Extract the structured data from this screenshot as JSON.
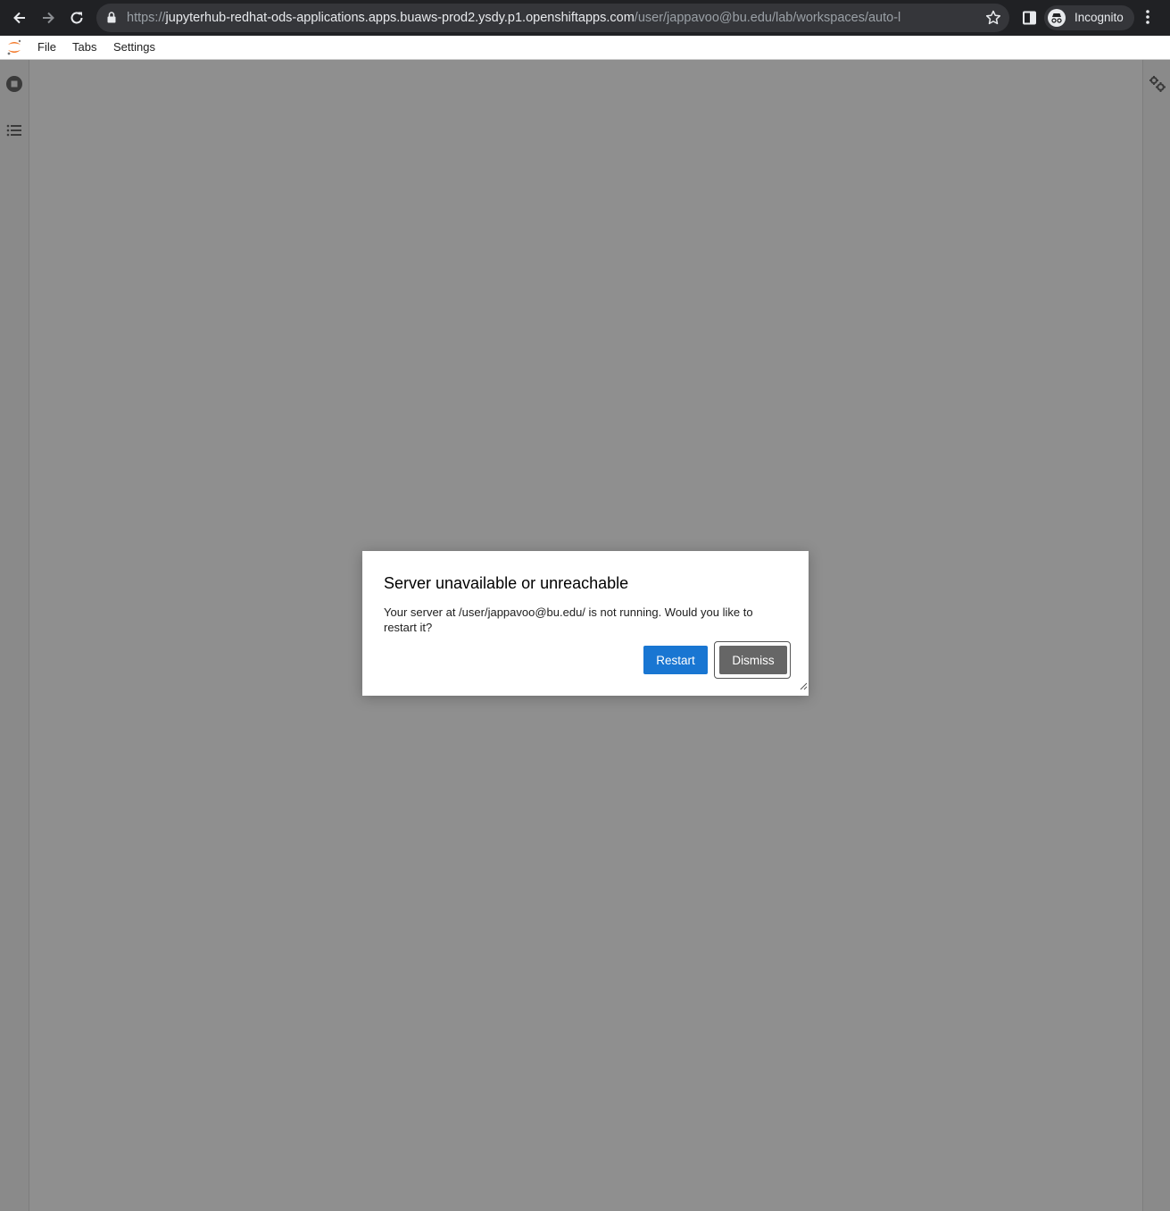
{
  "browser": {
    "url_scheme": "https://",
    "url_host": "jupyterhub-redhat-ods-applications.apps.buaws-prod2.ysdy.p1.openshiftapps.com",
    "url_path": "/user/jappavoo@bu.edu/lab/workspaces/auto-l",
    "profile_label": "Incognito"
  },
  "menubar": {
    "items": [
      {
        "label": "File"
      },
      {
        "label": "Tabs"
      },
      {
        "label": "Settings"
      }
    ]
  },
  "left_sidebar": {
    "icons": [
      "running-sessions-icon",
      "table-of-contents-icon"
    ]
  },
  "right_sidebar": {
    "icons": [
      "property-inspector-icon"
    ]
  },
  "dialog": {
    "title": "Server unavailable or unreachable",
    "body": "Your server at /user/jappavoo@bu.edu/ is not running. Would you like to restart it?",
    "restart_label": "Restart",
    "dismiss_label": "Dismiss"
  },
  "colors": {
    "accent": "#1976d2",
    "overlay": "#8f8f8f",
    "dismiss": "#666666",
    "jupyter_orange": "#f37726"
  }
}
